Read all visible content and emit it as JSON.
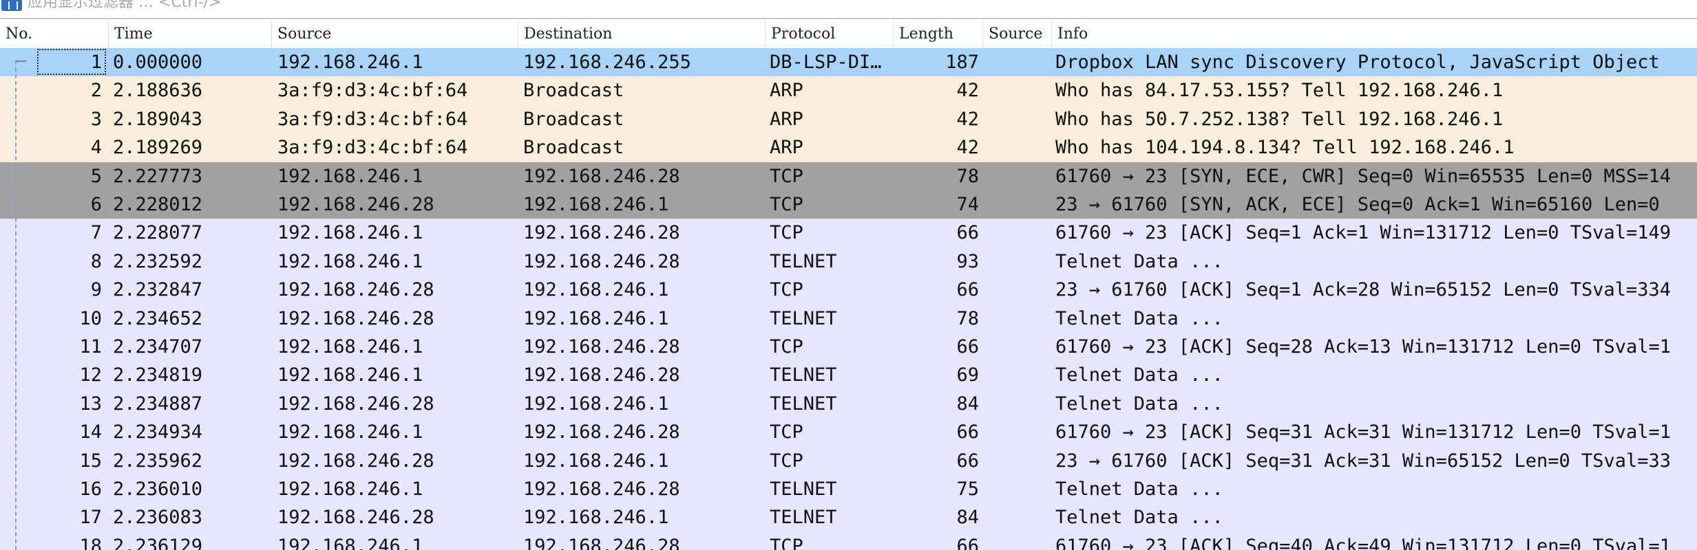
{
  "filter": {
    "placeholder": "应用显示过滤器 … <Ctrl-/>"
  },
  "columns": [
    {
      "label": "No."
    },
    {
      "label": "Time"
    },
    {
      "label": "Source"
    },
    {
      "label": "Destination"
    },
    {
      "label": "Protocol"
    },
    {
      "label": "Length"
    },
    {
      "label": "Source"
    },
    {
      "label": "Info"
    }
  ],
  "rows": [
    {
      "no": "1",
      "time": "0.000000",
      "source": "192.168.246.1",
      "destination": "192.168.246.255",
      "protocol": "DB-LSP-DI…",
      "length": "187",
      "source2": "",
      "info": "Dropbox LAN sync Discovery Protocol, JavaScript Object"
    },
    {
      "no": "2",
      "time": "2.188636",
      "source": "3a:f9:d3:4c:bf:64",
      "destination": "Broadcast",
      "protocol": "ARP",
      "length": "42",
      "source2": "",
      "info": "Who has 84.17.53.155? Tell 192.168.246.1"
    },
    {
      "no": "3",
      "time": "2.189043",
      "source": "3a:f9:d3:4c:bf:64",
      "destination": "Broadcast",
      "protocol": "ARP",
      "length": "42",
      "source2": "",
      "info": "Who has 50.7.252.138? Tell 192.168.246.1"
    },
    {
      "no": "4",
      "time": "2.189269",
      "source": "3a:f9:d3:4c:bf:64",
      "destination": "Broadcast",
      "protocol": "ARP",
      "length": "42",
      "source2": "",
      "info": "Who has 104.194.8.134? Tell 192.168.246.1"
    },
    {
      "no": "5",
      "time": "2.227773",
      "source": "192.168.246.1",
      "destination": "192.168.246.28",
      "protocol": "TCP",
      "length": "78",
      "source2": "",
      "info": "61760 → 23 [SYN, ECE, CWR] Seq=0 Win=65535 Len=0 MSS=14"
    },
    {
      "no": "6",
      "time": "2.228012",
      "source": "192.168.246.28",
      "destination": "192.168.246.1",
      "protocol": "TCP",
      "length": "74",
      "source2": "",
      "info": "23 → 61760 [SYN, ACK, ECE] Seq=0 Ack=1 Win=65160 Len=0"
    },
    {
      "no": "7",
      "time": "2.228077",
      "source": "192.168.246.1",
      "destination": "192.168.246.28",
      "protocol": "TCP",
      "length": "66",
      "source2": "",
      "info": "61760 → 23 [ACK] Seq=1 Ack=1 Win=131712 Len=0 TSval=149"
    },
    {
      "no": "8",
      "time": "2.232592",
      "source": "192.168.246.1",
      "destination": "192.168.246.28",
      "protocol": "TELNET",
      "length": "93",
      "source2": "",
      "info": "Telnet Data ..."
    },
    {
      "no": "9",
      "time": "2.232847",
      "source": "192.168.246.28",
      "destination": "192.168.246.1",
      "protocol": "TCP",
      "length": "66",
      "source2": "",
      "info": "23 → 61760 [ACK] Seq=1 Ack=28 Win=65152 Len=0 TSval=334"
    },
    {
      "no": "10",
      "time": "2.234652",
      "source": "192.168.246.28",
      "destination": "192.168.246.1",
      "protocol": "TELNET",
      "length": "78",
      "source2": "",
      "info": "Telnet Data ..."
    },
    {
      "no": "11",
      "time": "2.234707",
      "source": "192.168.246.1",
      "destination": "192.168.246.28",
      "protocol": "TCP",
      "length": "66",
      "source2": "",
      "info": "61760 → 23 [ACK] Seq=28 Ack=13 Win=131712 Len=0 TSval=1"
    },
    {
      "no": "12",
      "time": "2.234819",
      "source": "192.168.246.1",
      "destination": "192.168.246.28",
      "protocol": "TELNET",
      "length": "69",
      "source2": "",
      "info": "Telnet Data ..."
    },
    {
      "no": "13",
      "time": "2.234887",
      "source": "192.168.246.28",
      "destination": "192.168.246.1",
      "protocol": "TELNET",
      "length": "84",
      "source2": "",
      "info": "Telnet Data ..."
    },
    {
      "no": "14",
      "time": "2.234934",
      "source": "192.168.246.1",
      "destination": "192.168.246.28",
      "protocol": "TCP",
      "length": "66",
      "source2": "",
      "info": "61760 → 23 [ACK] Seq=31 Ack=31 Win=131712 Len=0 TSval=1"
    },
    {
      "no": "15",
      "time": "2.235962",
      "source": "192.168.246.28",
      "destination": "192.168.246.1",
      "protocol": "TCP",
      "length": "66",
      "source2": "",
      "info": "23 → 61760 [ACK] Seq=31 Ack=31 Win=65152 Len=0 TSval=33"
    },
    {
      "no": "16",
      "time": "2.236010",
      "source": "192.168.246.1",
      "destination": "192.168.246.28",
      "protocol": "TELNET",
      "length": "75",
      "source2": "",
      "info": "Telnet Data ..."
    },
    {
      "no": "17",
      "time": "2.236083",
      "source": "192.168.246.28",
      "destination": "192.168.246.1",
      "protocol": "TELNET",
      "length": "84",
      "source2": "",
      "info": "Telnet Data ..."
    },
    {
      "no": "18",
      "time": "2.236129",
      "source": "192.168.246.1",
      "destination": "192.168.246.28",
      "protocol": "TCP",
      "length": "66",
      "source2": "",
      "info": "61760 → 23 [ACK] Seq=40 Ack=49 Win=131712 Len=0 TSval=1"
    }
  ],
  "colors": {
    "selected": "#a9d3fb",
    "arp": "#f9eedb",
    "tcp_syn": "#a1a1a1",
    "normal": "#e7e5ff"
  }
}
